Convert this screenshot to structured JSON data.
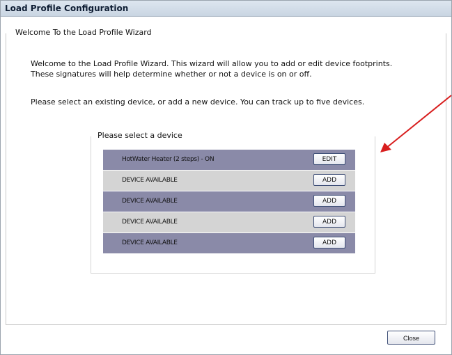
{
  "window": {
    "title": "Load Profile Configuration"
  },
  "wizard": {
    "legend": "Welcome To the Load Profile Wizard",
    "intro_line_1": "Welcome to the Load Profile Wizard. This wizard will allow you to add or edit device footprints.",
    "intro_line_2": "These signatures will help determine whether or not a device is on or off.",
    "select_instructions": "Please select an existing device, or add a new device. You can track up to five devices."
  },
  "device_panel": {
    "legend": "Please select a device",
    "rows": [
      {
        "label": "HotWater Heater (2 steps) - ON",
        "button": "EDIT"
      },
      {
        "label": "DEVICE AVAILABLE",
        "button": "ADD"
      },
      {
        "label": "DEVICE AVAILABLE",
        "button": "ADD"
      },
      {
        "label": "DEVICE AVAILABLE",
        "button": "ADD"
      },
      {
        "label": "DEVICE AVAILABLE",
        "button": "ADD"
      }
    ]
  },
  "footer": {
    "close_label": "Close"
  },
  "colors": {
    "title_bar": "#c9d5e2",
    "row_dark": "#8a8aa8",
    "row_light": "#d4d4d4",
    "annotation_arrow": "#d81e1e"
  },
  "annotation": {
    "icon": "red-arrow-pointer"
  }
}
